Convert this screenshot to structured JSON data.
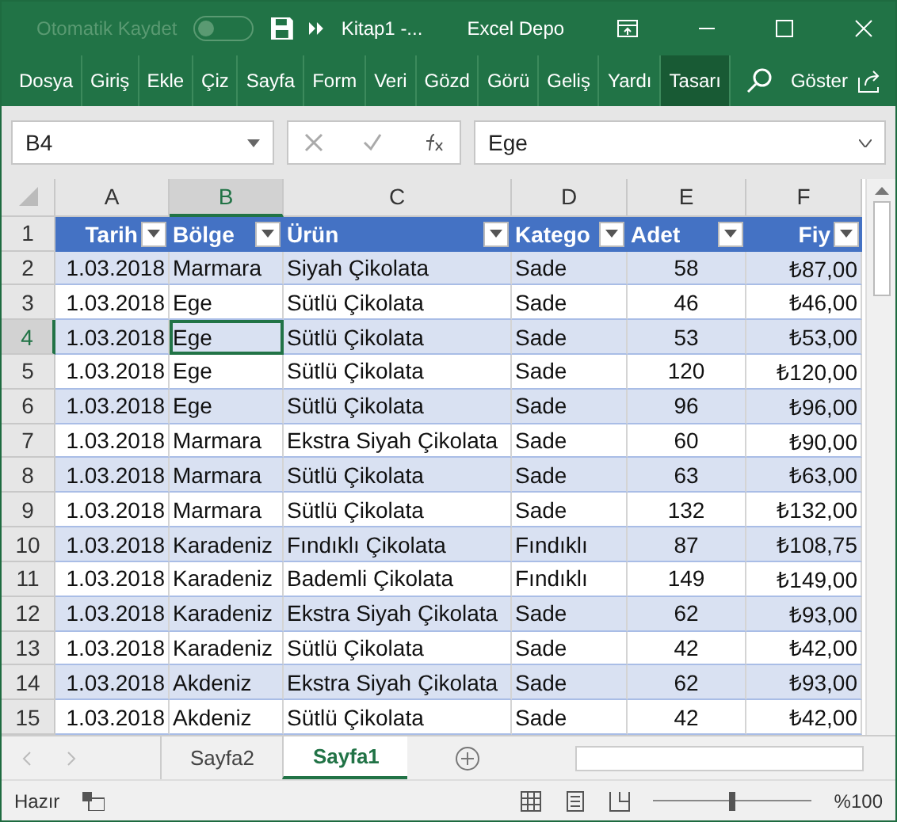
{
  "title_bar": {
    "autosave_label": "Otomatik Kaydet",
    "autosave_on": false,
    "title": "Kitap1  -...",
    "account": "Excel Depo"
  },
  "ribbon_tabs": [
    {
      "label": "Dosya",
      "selected": false
    },
    {
      "label": "Giriş",
      "selected": false
    },
    {
      "label": "Ekle",
      "selected": false
    },
    {
      "label": "Çiz",
      "selected": false
    },
    {
      "label": "Sayfa",
      "selected": false
    },
    {
      "label": "Form",
      "selected": false
    },
    {
      "label": "Veri",
      "selected": false
    },
    {
      "label": "Gözd",
      "selected": false
    },
    {
      "label": "Görü",
      "selected": false
    },
    {
      "label": "Geliş",
      "selected": false
    },
    {
      "label": "Yardı",
      "selected": false
    },
    {
      "label": "Tasarı",
      "selected": true
    }
  ],
  "tell_me": "Göster",
  "name_box": "B4",
  "formula": "Ege",
  "columns": [
    {
      "letter": "A",
      "selected": false
    },
    {
      "letter": "B",
      "selected": true
    },
    {
      "letter": "C",
      "selected": false
    },
    {
      "letter": "D",
      "selected": false
    },
    {
      "letter": "E",
      "selected": false
    },
    {
      "letter": "F",
      "selected": false
    }
  ],
  "table_headers": [
    "Tarih",
    "Bölge",
    "Ürün",
    "Katego",
    "Adet",
    "Fiy"
  ],
  "rows": [
    {
      "number": "2",
      "selected": false,
      "cells": [
        "1.03.2018",
        "Marmara",
        "Siyah Çikolata",
        "Sade",
        "58",
        "₺87,00"
      ]
    },
    {
      "number": "3",
      "selected": false,
      "cells": [
        "1.03.2018",
        "Ege",
        "Sütlü Çikolata",
        "Sade",
        "46",
        "₺46,00"
      ]
    },
    {
      "number": "4",
      "selected": true,
      "cells": [
        "1.03.2018",
        "Ege",
        "Sütlü Çikolata",
        "Sade",
        "53",
        "₺53,00"
      ]
    },
    {
      "number": "5",
      "selected": false,
      "cells": [
        "1.03.2018",
        "Ege",
        "Sütlü Çikolata",
        "Sade",
        "120",
        "₺120,00"
      ]
    },
    {
      "number": "6",
      "selected": false,
      "cells": [
        "1.03.2018",
        "Ege",
        "Sütlü Çikolata",
        "Sade",
        "96",
        "₺96,00"
      ]
    },
    {
      "number": "7",
      "selected": false,
      "cells": [
        "1.03.2018",
        "Marmara",
        "Ekstra Siyah Çikolata",
        "Sade",
        "60",
        "₺90,00"
      ]
    },
    {
      "number": "8",
      "selected": false,
      "cells": [
        "1.03.2018",
        "Marmara",
        "Sütlü Çikolata",
        "Sade",
        "63",
        "₺63,00"
      ]
    },
    {
      "number": "9",
      "selected": false,
      "cells": [
        "1.03.2018",
        "Marmara",
        "Sütlü Çikolata",
        "Sade",
        "132",
        "₺132,00"
      ]
    },
    {
      "number": "10",
      "selected": false,
      "cells": [
        "1.03.2018",
        "Karadeniz",
        "Fındıklı Çikolata",
        "Fındıklı",
        "87",
        "₺108,75"
      ]
    },
    {
      "number": "11",
      "selected": false,
      "cells": [
        "1.03.2018",
        "Karadeniz",
        "Bademli Çikolata",
        "Fındıklı",
        "149",
        "₺149,00"
      ]
    },
    {
      "number": "12",
      "selected": false,
      "cells": [
        "1.03.2018",
        "Karadeniz",
        "Ekstra Siyah Çikolata",
        "Sade",
        "62",
        "₺93,00"
      ]
    },
    {
      "number": "13",
      "selected": false,
      "cells": [
        "1.03.2018",
        "Karadeniz",
        "Sütlü Çikolata",
        "Sade",
        "42",
        "₺42,00"
      ]
    },
    {
      "number": "14",
      "selected": false,
      "cells": [
        "1.03.2018",
        "Akdeniz",
        "Ekstra Siyah Çikolata",
        "Sade",
        "62",
        "₺93,00"
      ]
    },
    {
      "number": "15",
      "selected": false,
      "cells": [
        "1.03.2018",
        "Akdeniz",
        "Sütlü Çikolata",
        "Sade",
        "42",
        "₺42,00"
      ]
    }
  ],
  "header_row_number": "1",
  "sheet_tabs": [
    {
      "label": "Sayfa2",
      "selected": false
    },
    {
      "label": "Sayfa1",
      "selected": true
    }
  ],
  "status": {
    "text": "Hazır",
    "zoom": "%100",
    "zoom_slider": {
      "level": 0.5
    }
  }
}
